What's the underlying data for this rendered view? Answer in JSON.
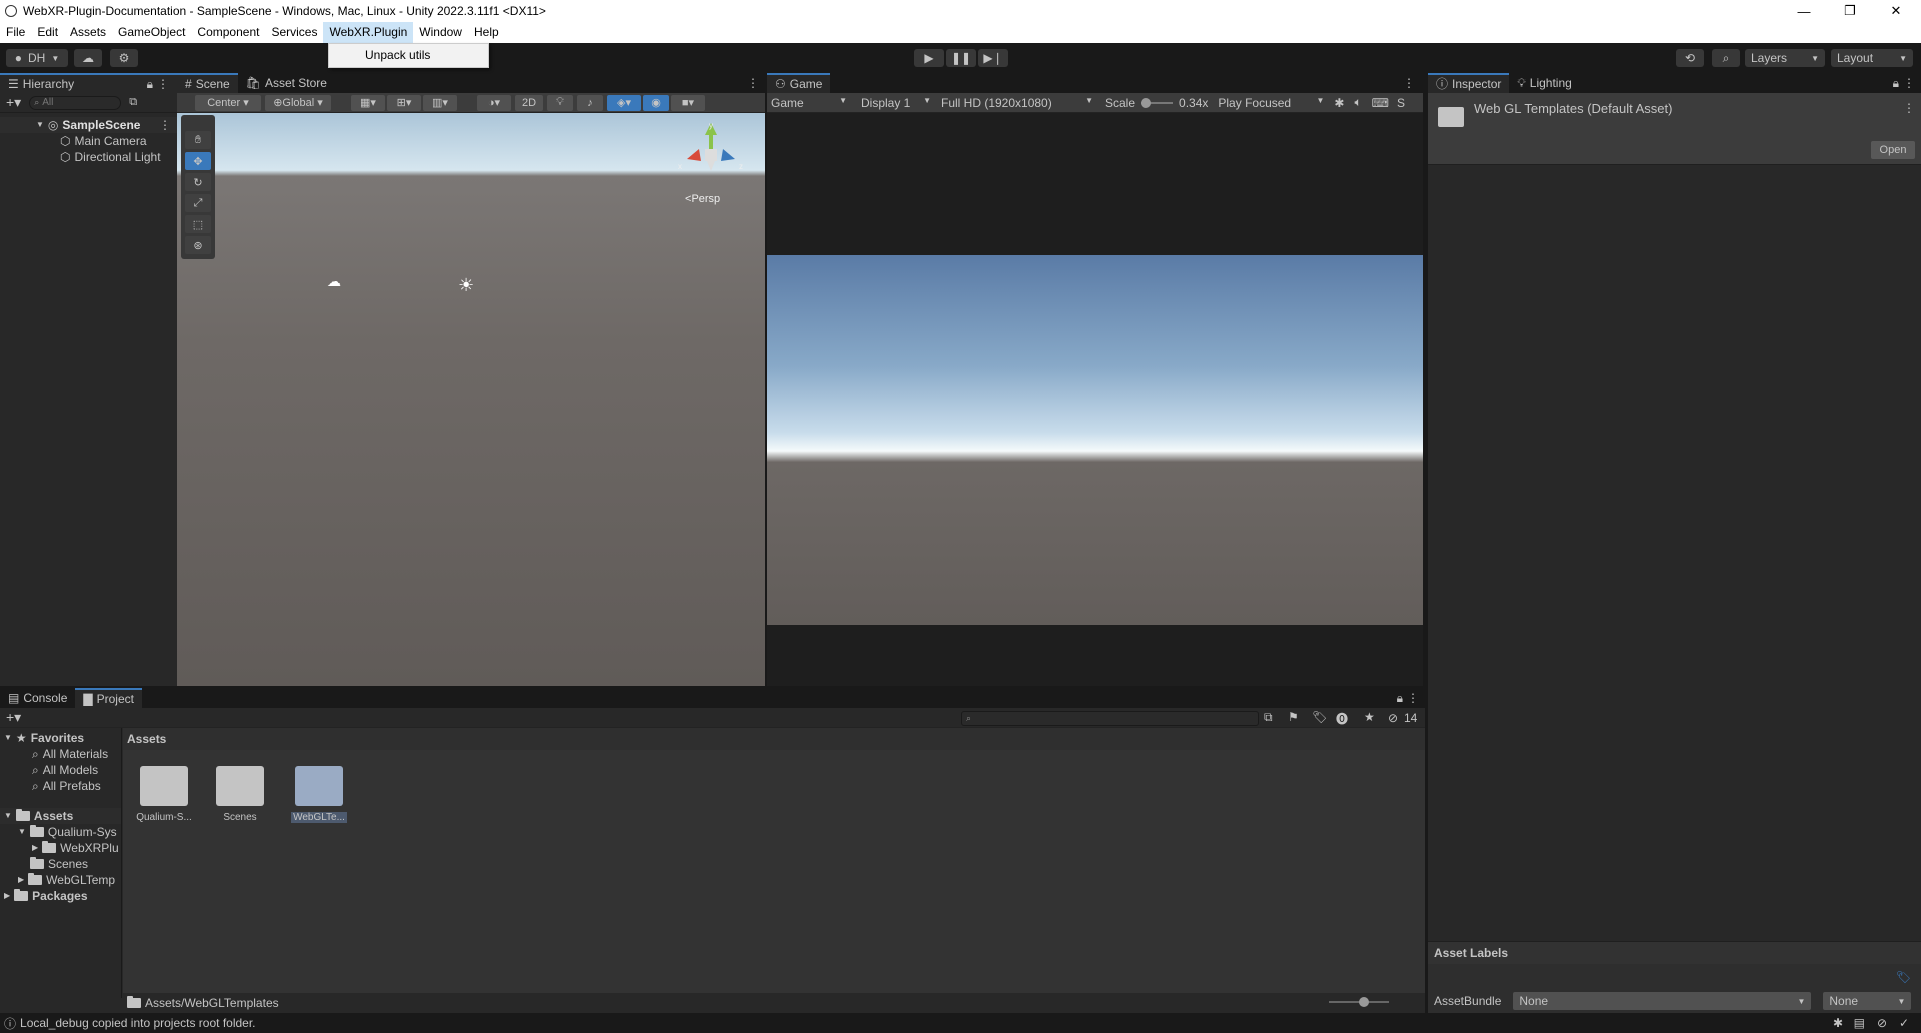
{
  "window": {
    "title": "WebXR-Plugin-Documentation - SampleScene - Windows, Mac, Linux - Unity 2022.3.11f1 <DX11>",
    "minimize": "—",
    "maximize": "❐",
    "close": "✕"
  },
  "menu": {
    "items": [
      "File",
      "Edit",
      "Assets",
      "GameObject",
      "Component",
      "Services",
      "WebXR.Plugin",
      "Window",
      "Help"
    ],
    "dropdown_item": "Unpack utils"
  },
  "toolbar": {
    "account": "DH",
    "layers": "Layers",
    "layout": "Layout"
  },
  "hierarchy": {
    "tab": "Hierarchy",
    "search_placeholder": "All",
    "scene": "SampleScene",
    "items": [
      "Main Camera",
      "Directional Light"
    ]
  },
  "scene_view": {
    "tabs": [
      "Scene",
      "Asset Store"
    ],
    "pivot": "Center",
    "space": "Global",
    "mode2d": "2D",
    "persp": "Persp",
    "axis_y": "y",
    "axis_x": "x",
    "axis_z": "z"
  },
  "game_view": {
    "tab": "Game",
    "game_dropdown": "Game",
    "display": "Display 1",
    "resolution": "Full HD (1920x1080)",
    "scale_label": "Scale",
    "scale_value": "0.34x",
    "play_mode": "Play Focused",
    "stats_partial": "S"
  },
  "inspector": {
    "tabs": [
      "Inspector",
      "Lighting"
    ],
    "asset_name": "Web GL Templates (Default Asset)",
    "open_button": "Open",
    "asset_labels": "Asset Labels",
    "assetbundle_label": "AssetBundle",
    "assetbundle_value": "None",
    "variant_value": "None"
  },
  "bottom": {
    "tabs": [
      "Console",
      "Project"
    ],
    "hidden_count": "14",
    "breadcrumb": "Assets",
    "path": "Assets/WebGLTemplates",
    "favorites": {
      "label": "Favorites",
      "items": [
        "All Materials",
        "All Models",
        "All Prefabs"
      ]
    },
    "assets_tree": {
      "label": "Assets",
      "children": [
        {
          "label": "Qualium-Sys",
          "children": [
            "WebXRPlu"
          ]
        },
        {
          "label": "Scenes"
        },
        {
          "label": "WebGLTemp"
        }
      ],
      "packages": "Packages"
    },
    "grid": [
      {
        "label": "Qualium-S..."
      },
      {
        "label": "Scenes"
      },
      {
        "label": "WebGLTe..."
      }
    ]
  },
  "status": {
    "message": "Local_debug copied into projects root folder."
  },
  "colors": {
    "accent": "#3a79bb",
    "panel": "#282828",
    "header": "#191919"
  }
}
